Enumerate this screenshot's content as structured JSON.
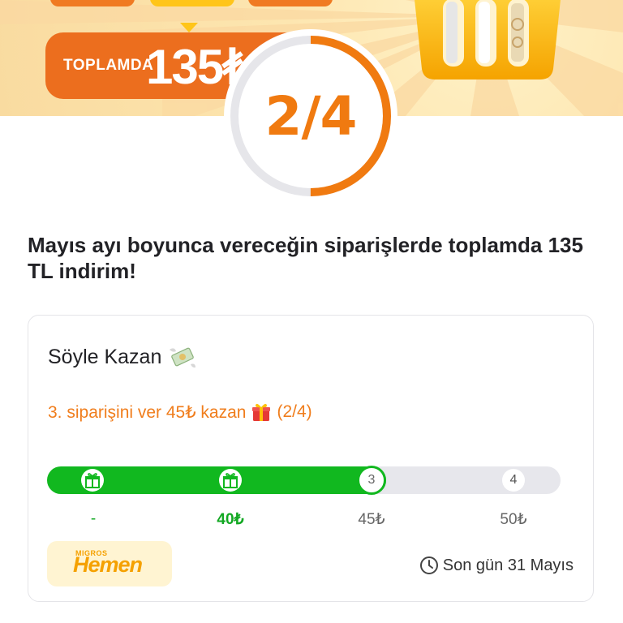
{
  "banner": {
    "total_label": "TOPLAMDA",
    "total_value": "135₺"
  },
  "progress": {
    "label": "2/4",
    "completed": 2,
    "total": 4,
    "accent_color": "#f07a10",
    "track_color": "#e6e6ea"
  },
  "headline": "Mayıs ayı boyunca vereceğin siparişlerde toplamda 135 TL indirim!",
  "card": {
    "title": "Söyle Kazan",
    "title_icon": "money-with-wings-icon",
    "task_text": "3. siparişini ver 45₺ kazan",
    "task_icon": "gift-icon",
    "task_progress": "(2/4)",
    "steps": [
      {
        "marker": "gift-icon",
        "reward": "-",
        "state": "done"
      },
      {
        "marker": "gift-icon",
        "reward": "40₺",
        "state": "done"
      },
      {
        "marker": "3",
        "reward": "45₺",
        "state": "current"
      },
      {
        "marker": "4",
        "reward": "50₺",
        "state": "upcoming"
      }
    ],
    "brand_small": "MIGROS",
    "brand_main": "Hemen",
    "deadline_icon": "clock-icon",
    "deadline": "Son gün 31 Mayıs",
    "colors": {
      "done": "#11b81f",
      "orange": "#f07d1c"
    }
  }
}
